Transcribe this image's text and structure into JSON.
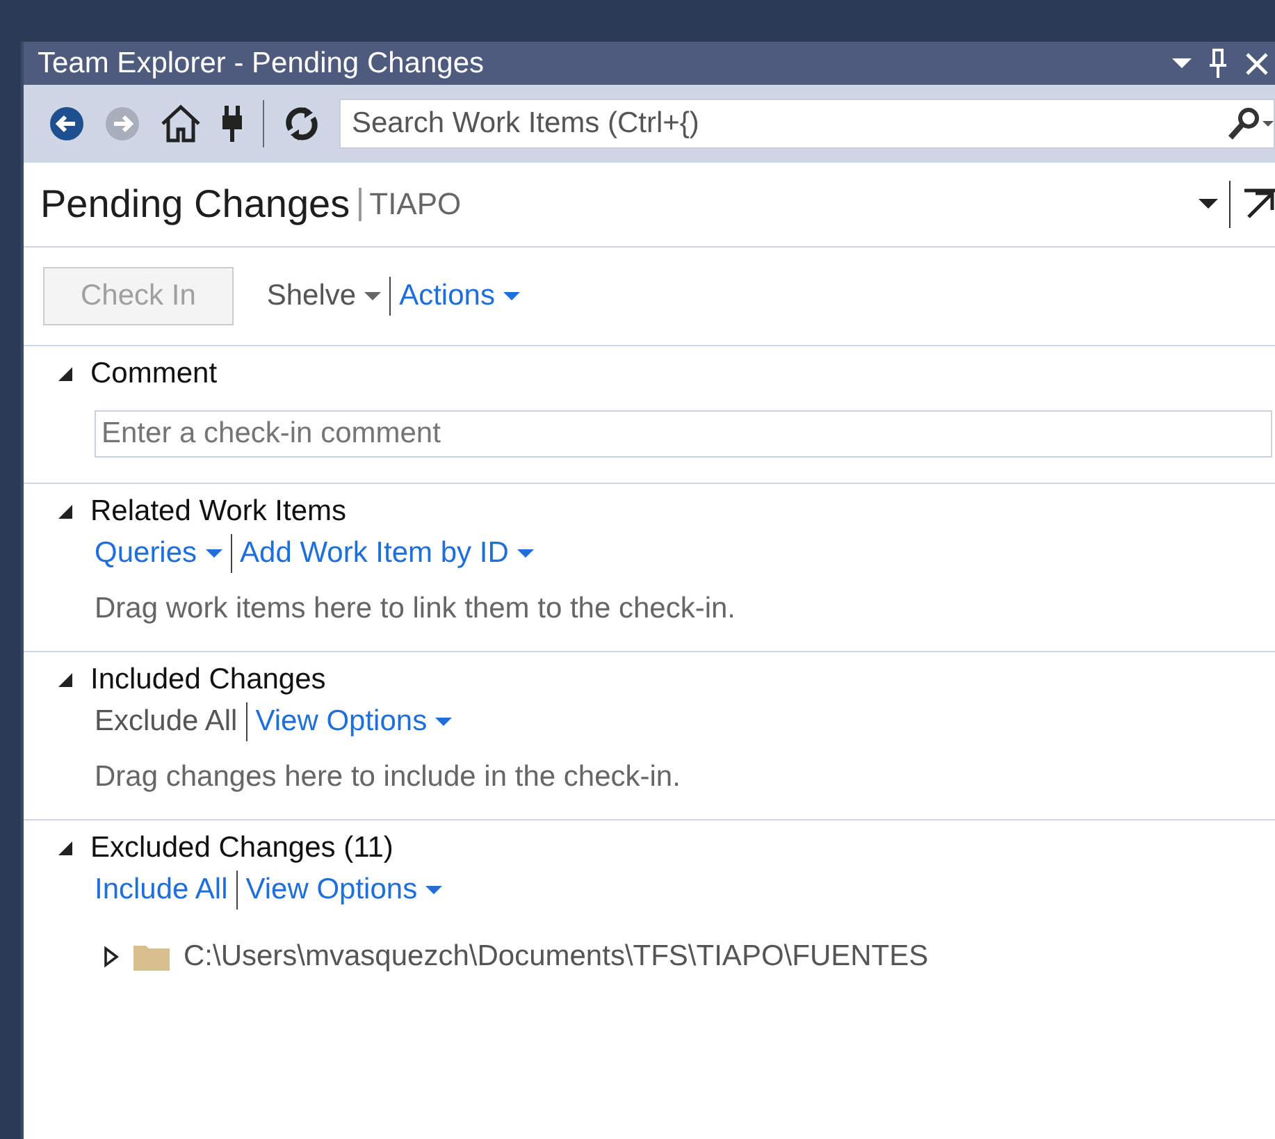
{
  "window": {
    "title": "Team Explorer - Pending Changes"
  },
  "toolbar": {
    "back_disabled": false,
    "forward_disabled": true,
    "search": {
      "placeholder": "Search Work Items (Ctrl+{)"
    }
  },
  "header": {
    "title": "Pending Changes",
    "context": "TIAPO"
  },
  "actions": [
    {
      "label": "Check In",
      "kind": "button",
      "disabled": true
    },
    {
      "label": "Shelve",
      "kind": "plain",
      "dropdown": true
    },
    {
      "label": "Actions",
      "kind": "link",
      "dropdown": true
    }
  ],
  "sections": [
    {
      "title": "Comment",
      "expanded": true,
      "field": {
        "placeholder": "Enter a check-in comment"
      }
    },
    {
      "title": "Related Work Items",
      "expanded": true,
      "links": [
        {
          "label": "Queries",
          "kind": "link",
          "dropdown": true
        },
        {
          "label": "Add Work Item by ID",
          "kind": "link",
          "dropdown": true
        }
      ],
      "hint": "Drag work items here to link them to the check-in."
    },
    {
      "title": "Included Changes",
      "expanded": true,
      "links": [
        {
          "label": "Exclude All",
          "kind": "plain",
          "dropdown": false
        },
        {
          "label": "View Options",
          "kind": "link",
          "dropdown": true
        }
      ],
      "hint": "Drag changes here to include in the check-in."
    },
    {
      "title": "Excluded Changes (11)",
      "expanded": true,
      "links": [
        {
          "label": "Include All",
          "kind": "link",
          "dropdown": false
        },
        {
          "label": "View Options",
          "kind": "link",
          "dropdown": true
        }
      ],
      "tree": [
        {
          "label": "C:\\Users\\mvasquezch\\Documents\\TFS\\TIAPO\\FUENTES",
          "expanded": false
        }
      ]
    }
  ]
}
